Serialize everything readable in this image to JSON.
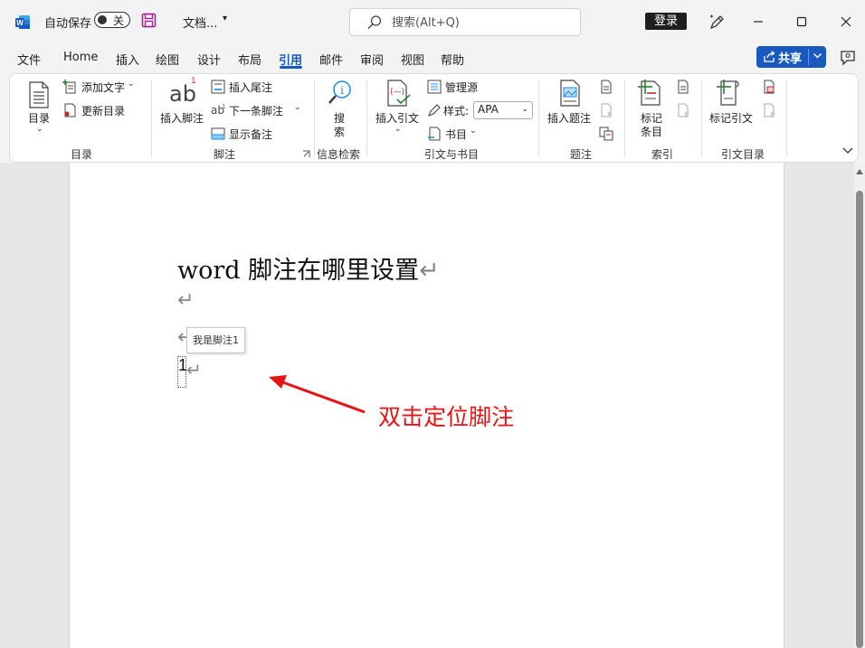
{
  "titlebar": {
    "autosave_label": "自动保存",
    "autosave_state": "关",
    "doc_name": "文档...",
    "search_placeholder": "搜索(Alt+Q)",
    "login_label": "登录"
  },
  "menu": {
    "tabs": [
      "文件",
      "Home",
      "插入",
      "绘图",
      "设计",
      "布局",
      "引用",
      "邮件",
      "审阅",
      "视图",
      "帮助"
    ],
    "active_tab": "引用",
    "share_label": "共享"
  },
  "ribbon": {
    "toc": {
      "button": "目录",
      "add_text": "添加文字",
      "update_toc": "更新目录",
      "label": "目录"
    },
    "footnotes": {
      "insert_footnote": "插入脚注",
      "superscript": "1",
      "insert_endnote": "插入尾注",
      "next_footnote": "下一条脚注",
      "show_notes": "显示备注",
      "label": "脚注"
    },
    "research": {
      "search_line1": "搜",
      "search_line2": "索",
      "label": "信息检索"
    },
    "citations": {
      "insert_citation": "插入引文",
      "manage_sources": "管理源",
      "style_label": "样式:",
      "style_value": "APA",
      "bibliography": "书目",
      "label": "引文与书目"
    },
    "captions": {
      "insert_caption": "插入题注",
      "label": "题注"
    },
    "index": {
      "mark_line1": "标记",
      "mark_line2": "条目",
      "label": "索引"
    },
    "toa": {
      "mark_citation": "标记引文",
      "label": "引文目录"
    }
  },
  "document": {
    "heading": "word 脚注在哪里设置",
    "tooltip": "我是脚注1",
    "footnote_number": "1",
    "annotation": "双击定位脚注"
  },
  "colors": {
    "accent": "#185abd",
    "annotation": "#e61515"
  }
}
